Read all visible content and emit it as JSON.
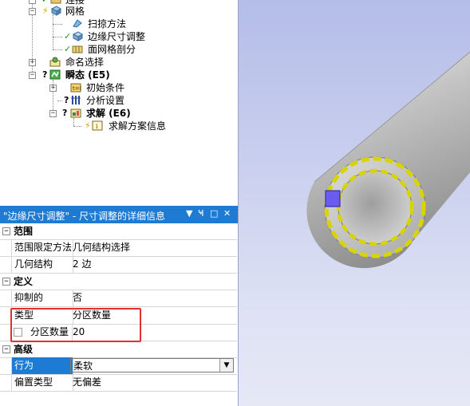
{
  "tree": {
    "items": [
      {
        "label": "连接"
      },
      {
        "label": "网格"
      },
      {
        "label": "扫掠方法"
      },
      {
        "label": "边缘尺寸调整"
      },
      {
        "label": "面网格剖分"
      },
      {
        "label": "命名选择"
      },
      {
        "label": "瞬态 (E5)"
      },
      {
        "label": "初始条件"
      },
      {
        "label": "分析设置"
      },
      {
        "label": "求解 (E6)"
      },
      {
        "label": "求解方案信息"
      }
    ]
  },
  "details": {
    "title": "\"边缘尺寸调整\" - 尺寸调整的详细信息",
    "controls": {
      "menu": "▼",
      "pin": "Ҹ",
      "maximize": "□",
      "close": "✕"
    },
    "sections": {
      "scope": {
        "label": "范围",
        "rows": [
          {
            "key": "范围限定方法",
            "value": "几何结构选择"
          },
          {
            "key": "几何结构",
            "value": "2 边"
          }
        ]
      },
      "definition": {
        "label": "定义",
        "rows": [
          {
            "key": "抑制的",
            "value": "否"
          },
          {
            "key": "类型",
            "value": "分区数量"
          },
          {
            "key": "分区数量",
            "value": "20"
          }
        ]
      },
      "advanced": {
        "label": "高级",
        "rows": [
          {
            "key": "行为",
            "value": "柔软"
          },
          {
            "key": "偏置类型",
            "value": "无偏差"
          }
        ]
      }
    }
  },
  "colors": {
    "title_bar": "#1e7bd3",
    "selected_row": "#1e7bd3",
    "highlight_box": "#e03030",
    "edge_yellow": "#d8d400",
    "vertex_marker": "#6a5cf0"
  }
}
